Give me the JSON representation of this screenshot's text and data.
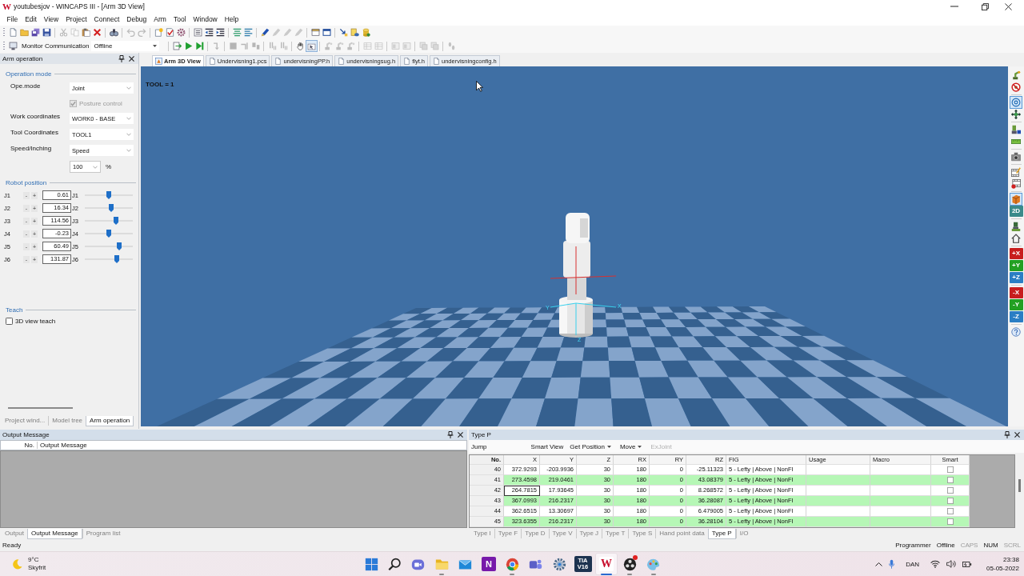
{
  "title_bar": {
    "logo": "W",
    "title": "youtubesjov - WINCAPS III - [Arm 3D View]"
  },
  "menu": [
    "File",
    "Edit",
    "View",
    "Project",
    "Connect",
    "Debug",
    "Arm",
    "Tool",
    "Window",
    "Help"
  ],
  "toolbar_main": [
    [
      {
        "disabled": false
      },
      {
        "disabled": false
      },
      {
        "disabled": false
      },
      {
        "disabled": false
      }
    ],
    [
      {
        "disabled": true
      },
      {
        "disabled": true
      },
      {
        "disabled": false
      },
      {
        "disabled": false
      }
    ],
    [
      {
        "disabled": false
      }
    ],
    [
      {
        "disabled": true
      },
      {
        "disabled": true
      }
    ],
    [
      {
        "disabled": false
      },
      {
        "disabled": false
      },
      {
        "disabled": false
      }
    ],
    [
      {
        "disabled": false
      },
      {
        "disabled": false
      },
      {
        "disabled": false
      }
    ],
    [
      {
        "disabled": false
      },
      {
        "disabled": false
      }
    ],
    [
      {
        "disabled": false
      },
      {
        "disabled": true
      },
      {
        "disabled": true
      },
      {
        "disabled": true
      }
    ],
    [
      {
        "disabled": false
      },
      {
        "disabled": false
      }
    ],
    [
      {
        "disabled": false
      },
      {
        "disabled": false
      },
      {
        "disabled": false
      }
    ]
  ],
  "toolbar_monitor": {
    "label": "Monitor Communication",
    "value": "Offline",
    "groups": [
      [
        {
          "disabled": false,
          "selected": false
        },
        {
          "disabled": false,
          "selected": false
        },
        {
          "disabled": false,
          "selected": false
        }
      ],
      [
        {
          "disabled": true,
          "selected": false
        }
      ],
      [
        {
          "disabled": true,
          "selected": false
        },
        {
          "disabled": true,
          "selected": false
        },
        {
          "disabled": true,
          "selected": false
        }
      ],
      [
        {
          "disabled": true,
          "selected": false
        },
        {
          "disabled": true,
          "selected": false
        }
      ],
      [
        {
          "disabled": false,
          "selected": false
        },
        {
          "disabled": false,
          "selected": true
        }
      ],
      [
        {
          "disabled": true,
          "selected": false
        },
        {
          "disabled": true,
          "selected": false
        },
        {
          "disabled": true,
          "selected": false
        }
      ],
      [
        {
          "disabled": true,
          "selected": false
        },
        {
          "disabled": true,
          "selected": false
        }
      ],
      [
        {
          "disabled": true,
          "selected": false
        },
        {
          "disabled": true,
          "selected": false
        }
      ],
      [
        {
          "disabled": true,
          "selected": false
        },
        {
          "disabled": true,
          "selected": false
        }
      ],
      [
        {
          "disabled": true,
          "selected": false
        }
      ]
    ]
  },
  "arm_panel": {
    "title": "Arm operation",
    "operation_heading": "Operation mode",
    "ope_mode": {
      "label": "Ope.mode",
      "value": "Joint"
    },
    "posture": {
      "label": "Posture control",
      "checked": true,
      "disabled": true
    },
    "selects": [
      {
        "label": "Work coordinates",
        "value": "WORK0 - BASE"
      },
      {
        "label": "Tool Coordinates",
        "value": "TOOL1"
      },
      {
        "label": "Speed/Inching",
        "value": "Speed"
      }
    ],
    "speed": {
      "value": "100",
      "unit": "%"
    },
    "position_heading": "Robot position",
    "joints": [
      {
        "name": "J1",
        "minus": "-",
        "plus": "+",
        "value": "0.61",
        "axis": "J1",
        "level": 0.5
      },
      {
        "name": "J2",
        "minus": "-",
        "plus": "+",
        "value": "16.34",
        "axis": "J2",
        "level": 0.55
      },
      {
        "name": "J3",
        "minus": "-",
        "plus": "+",
        "value": "114.56",
        "axis": "J3",
        "level": 0.65
      },
      {
        "name": "J4",
        "minus": "-",
        "plus": "+",
        "value": "-0.23",
        "axis": "J4",
        "level": 0.5
      },
      {
        "name": "J5",
        "minus": "-",
        "plus": "+",
        "value": "60.49",
        "axis": "J5",
        "level": 0.72
      },
      {
        "name": "J6",
        "minus": "-",
        "plus": "+",
        "value": "131.87",
        "axis": "J6",
        "level": 0.67
      }
    ],
    "teach_heading": "Teach",
    "teach_option": {
      "label": "3D view teach",
      "checked": false
    },
    "tabs": [
      {
        "label": "Project wind...",
        "selected": false
      },
      {
        "label": "Model tree",
        "selected": false
      },
      {
        "label": "Arm operation",
        "selected": true
      }
    ]
  },
  "doc_tabs": [
    {
      "label": "Arm 3D View",
      "selected": true
    },
    {
      "label": "Undervisning1.pcs",
      "selected": false
    },
    {
      "label": "undervisningPP.h",
      "selected": false
    },
    {
      "label": "undervisningsug.h",
      "selected": false
    },
    {
      "label": "flyt.h",
      "selected": false
    },
    {
      "label": "undervisningconfig.h",
      "selected": false
    }
  ],
  "view": {
    "overlay": "TOOL = 1",
    "axis_labels": [
      "Y",
      "X",
      "Z"
    ]
  },
  "right_toolbar": [
    [
      {
        "kind": "icon",
        "selected": false
      },
      {
        "kind": "icon",
        "selected": false
      }
    ],
    [
      {
        "kind": "icon",
        "selected": true
      },
      {
        "kind": "icon",
        "selected": false
      }
    ],
    [
      {
        "kind": "icon",
        "selected": false
      },
      {
        "kind": "icon",
        "selected": false
      }
    ],
    [
      {
        "kind": "icon",
        "selected": false
      }
    ],
    [
      {
        "kind": "icon",
        "selected": false
      },
      {
        "kind": "icon",
        "selected": false
      }
    ],
    [
      {
        "kind": "icon",
        "selected": true
      },
      {
        "kind": "tile",
        "label": "2D",
        "color": "#3a8a8a",
        "selected": false
      }
    ],
    [
      {
        "kind": "icon",
        "selected": false
      },
      {
        "kind": "icon",
        "selected": false
      }
    ],
    [
      {
        "kind": "tile",
        "label": "+X",
        "color": "#c81e1e",
        "selected": false
      },
      {
        "kind": "tile",
        "label": "+Y",
        "color": "#22a022",
        "selected": false
      },
      {
        "kind": "tile",
        "label": "+Z",
        "color": "#2a7ec4",
        "selected": false
      }
    ],
    [
      {
        "kind": "tile",
        "label": "-X",
        "color": "#c81e1e",
        "selected": false
      },
      {
        "kind": "tile",
        "label": "-Y",
        "color": "#22a022",
        "selected": false
      },
      {
        "kind": "tile",
        "label": "-Z",
        "color": "#2a7ec4",
        "selected": false
      }
    ],
    [
      {
        "kind": "icon",
        "selected": false
      }
    ]
  ],
  "output_panel": {
    "title": "Output Message",
    "columns": [
      "No.",
      "Output Message"
    ],
    "tabs": [
      {
        "label": "Output",
        "selected": false
      },
      {
        "label": "Output Message",
        "selected": true
      },
      {
        "label": "Program list",
        "selected": false
      }
    ]
  },
  "type_p": {
    "title": "Type P",
    "toolbar": [
      {
        "kind": "label",
        "label": "Jump",
        "disabled": false
      },
      {
        "kind": "button",
        "label": "Smart View",
        "disabled": false
      },
      {
        "kind": "menu",
        "label": "Get Position",
        "disabled": false
      },
      {
        "kind": "menu",
        "label": "Move",
        "disabled": false
      },
      {
        "kind": "button",
        "label": "ExJoint",
        "disabled": true
      }
    ],
    "columns": [
      {
        "label": "No.",
        "kind": "index"
      },
      {
        "label": "X",
        "kind": "number"
      },
      {
        "label": "Y",
        "kind": "number"
      },
      {
        "label": "Z",
        "kind": "number"
      },
      {
        "label": "RX",
        "kind": "number"
      },
      {
        "label": "RY",
        "kind": "number"
      },
      {
        "label": "RZ",
        "kind": "number"
      },
      {
        "label": "FIG",
        "kind": "text"
      },
      {
        "label": "Usage",
        "kind": "text"
      },
      {
        "label": "Macro",
        "kind": "text"
      },
      {
        "label": "Smart",
        "kind": "check"
      }
    ],
    "rows": [
      {
        "cells": [
          "40",
          "372.9293",
          "-203.9936",
          "30",
          "180",
          "0",
          "-25.11323",
          "5 - Lefty | Above | NonFl"
        ],
        "highlighted": false,
        "selected": false,
        "smart": false
      },
      {
        "cells": [
          "41",
          "273.4598",
          "219.0461",
          "30",
          "180",
          "0",
          "43.08379",
          "5 - Lefty | Above | NonFl"
        ],
        "highlighted": true,
        "selected": false,
        "smart": false
      },
      {
        "cells": [
          "42",
          "264.7815",
          "17.93645",
          "30",
          "180",
          "0",
          "8.268572",
          "5 - Lefty | Above | NonFl"
        ],
        "highlighted": false,
        "selected": true,
        "smart": false
      },
      {
        "cells": [
          "43",
          "367.0993",
          "216.2317",
          "30",
          "180",
          "0",
          "36.28087",
          "5 - Lefty | Above | NonFl"
        ],
        "highlighted": true,
        "selected": false,
        "smart": false
      },
      {
        "cells": [
          "44",
          "362.6515",
          "13.30697",
          "30",
          "180",
          "0",
          "6.479005",
          "5 - Lefty | Above | NonFl"
        ],
        "highlighted": false,
        "selected": false,
        "smart": false
      },
      {
        "cells": [
          "45",
          "323.6355",
          "216.2317",
          "30",
          "180",
          "0",
          "36.28104",
          "5 - Lefty | Above | NonFl"
        ],
        "highlighted": true,
        "selected": false,
        "smart": false
      }
    ],
    "tabs": [
      {
        "label": "Type I",
        "selected": false
      },
      {
        "label": "Type F",
        "selected": false
      },
      {
        "label": "Type D",
        "selected": false
      },
      {
        "label": "Type V",
        "selected": false
      },
      {
        "label": "Type J",
        "selected": false
      },
      {
        "label": "Type T",
        "selected": false
      },
      {
        "label": "Type S",
        "selected": false
      },
      {
        "label": "Hand point data",
        "selected": false
      },
      {
        "label": "Type P",
        "selected": true
      },
      {
        "label": "I/O",
        "selected": false
      }
    ]
  },
  "status_bar": {
    "text": "Ready",
    "indicators": [
      {
        "label": "Programmer",
        "disabled": false
      },
      {
        "label": "Offline",
        "disabled": false
      },
      {
        "label": "CAPS",
        "disabled": true
      },
      {
        "label": "NUM",
        "disabled": false
      },
      {
        "label": "SCRL",
        "disabled": true
      }
    ]
  },
  "taskbar": {
    "weather": {
      "temperature": "9°C",
      "condition": "Skyfrit"
    },
    "apps": [
      {
        "kind": "icon",
        "running": false,
        "active": false,
        "notification": false
      },
      {
        "kind": "icon",
        "running": false,
        "active": false,
        "notification": false
      },
      {
        "kind": "icon",
        "running": false,
        "active": false,
        "notification": false
      },
      {
        "kind": "icon",
        "running": true,
        "active": false,
        "notification": false
      },
      {
        "kind": "icon",
        "running": false,
        "active": false,
        "notification": false
      },
      {
        "kind": "tile",
        "label": "N",
        "running": false,
        "active": false,
        "notification": false
      },
      {
        "kind": "icon",
        "running": true,
        "active": false,
        "notification": false
      },
      {
        "kind": "icon",
        "running": false,
        "active": false,
        "notification": false
      },
      {
        "kind": "icon",
        "running": false,
        "active": false,
        "notification": false
      },
      {
        "kind": "tile",
        "label": "TIA",
        "sublabel": "V16",
        "running": false,
        "active": false,
        "notification": false
      },
      {
        "kind": "tile",
        "label": "W",
        "running": true,
        "active": true,
        "notification": false
      },
      {
        "kind": "icon",
        "running": true,
        "active": false,
        "notification": true
      },
      {
        "kind": "icon",
        "running": true,
        "active": false,
        "notification": false
      }
    ],
    "tray": {
      "language": "DAN",
      "time": "23:38",
      "date": "05-05-2022"
    }
  }
}
